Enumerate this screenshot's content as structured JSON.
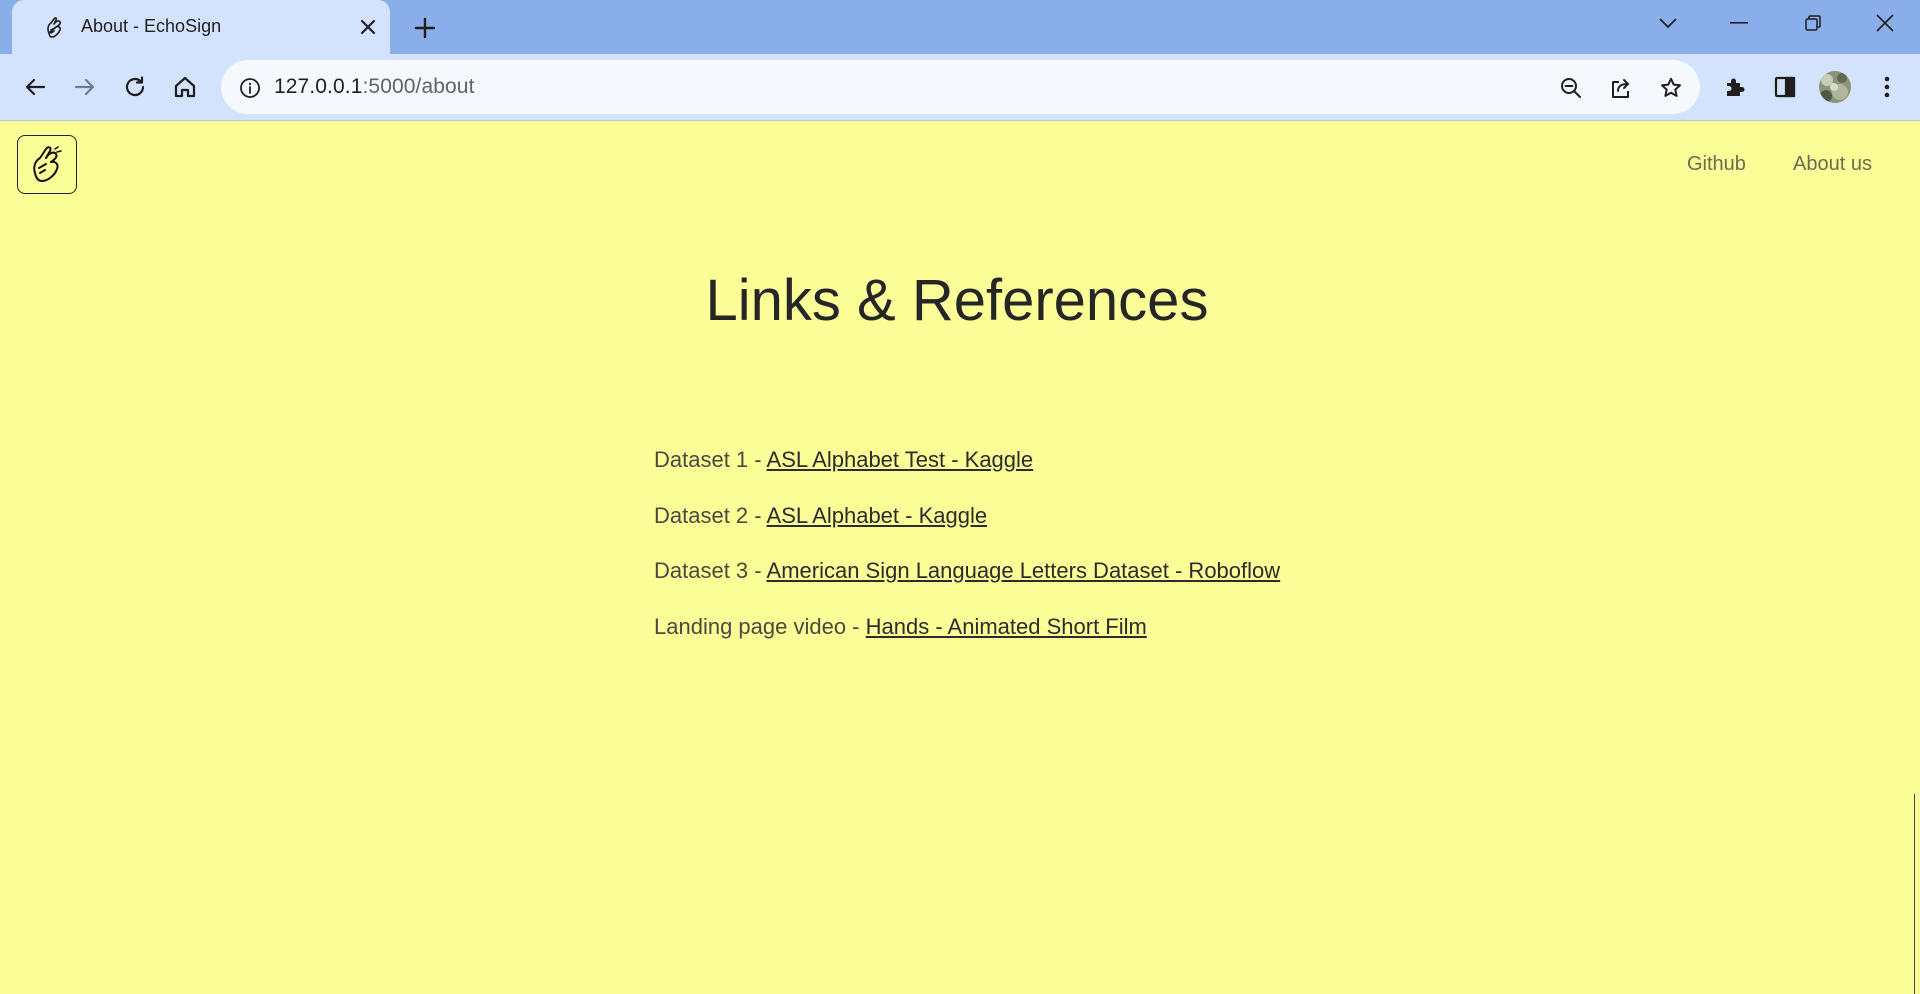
{
  "browser": {
    "tab": {
      "title": "About - EchoSign",
      "favicon": "hand-icon"
    },
    "address": {
      "host": "127.0.0.1",
      "path": ":5000/about"
    },
    "icons": {
      "back": "arrow-left-icon",
      "forward": "arrow-right-icon",
      "reload": "reload-icon",
      "home": "home-icon",
      "info": "info-icon",
      "zoom": "zoom-out-icon",
      "share": "share-icon",
      "bookmark": "star-icon",
      "extensions": "puzzle-icon",
      "sidepanel": "sidepanel-icon",
      "profile": "avatar",
      "menu": "kebab-menu-icon"
    }
  },
  "site": {
    "nav": {
      "github": "Github",
      "about": "About us"
    },
    "heading": "Links & References",
    "references": [
      {
        "label": "Dataset 1 - ",
        "link": "ASL Alphabet Test - Kaggle"
      },
      {
        "label": "Dataset 2 - ",
        "link": "ASL Alphabet - Kaggle"
      },
      {
        "label": "Dataset 3 - ",
        "link": "American Sign Language Letters Dataset - Roboflow"
      },
      {
        "label": "Landing page video - ",
        "link": "Hands - Animated Short Film"
      }
    ]
  },
  "colors": {
    "page_bg": "#fbfd97",
    "tabstrip_bg": "#8aaee9",
    "toolbar_bg": "#d3e3fd",
    "heading_text": "#262626"
  }
}
